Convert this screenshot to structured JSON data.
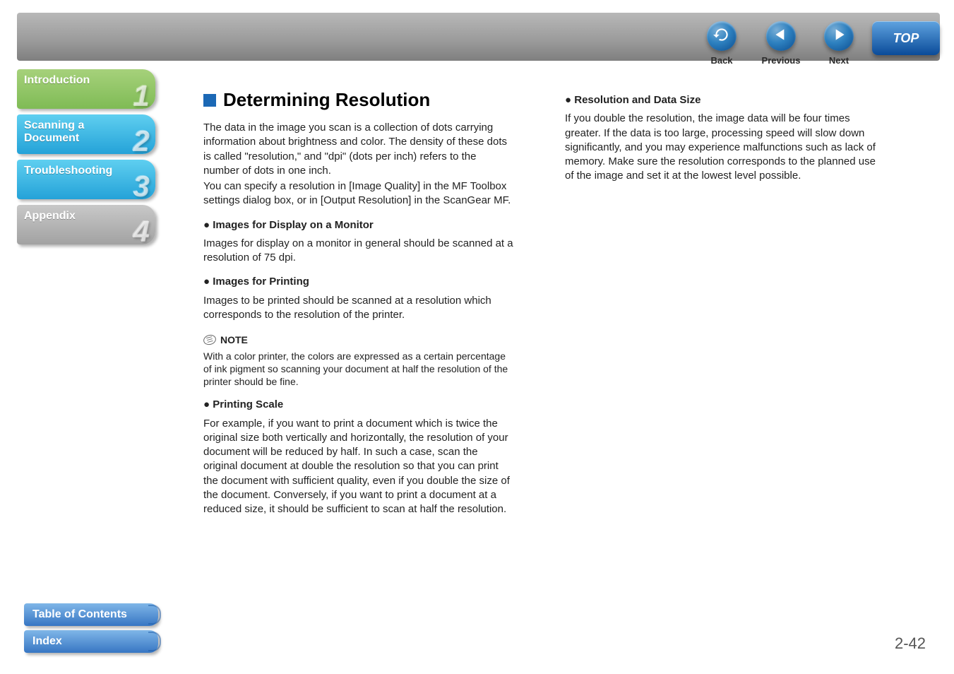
{
  "topnav": {
    "back": {
      "label": "Back"
    },
    "previous": {
      "label": "Previous"
    },
    "next": {
      "label": "Next"
    },
    "top": {
      "label": "TOP"
    }
  },
  "sidebar": {
    "tabs": [
      {
        "label": "Introduction",
        "num": "1",
        "color": "green"
      },
      {
        "label": "Scanning a\nDocument",
        "num": "2",
        "color": "cyan"
      },
      {
        "label": "Troubleshooting",
        "num": "3",
        "color": "cyan"
      },
      {
        "label": "Appendix",
        "num": "4",
        "color": "grey"
      }
    ]
  },
  "bottom": {
    "toc": "Table of Contents",
    "index": "Index"
  },
  "page_number": "2-42",
  "main": {
    "heading": "Determining Resolution",
    "intro1": "The data in the image you scan is a collection of dots carrying information about brightness and color. The density of these dots is called \"resolution,\" and \"dpi\" (dots per inch) refers to the number of dots in one inch.",
    "intro2": "You can specify a resolution in [Image Quality] in the MF Toolbox settings dialog box, or in [Output Resolution] in the ScanGear MF.",
    "sub1_title": "Images for Display on a Monitor",
    "sub1_body": "Images for display on a monitor in general should be scanned at a resolution of 75 dpi.",
    "sub2_title": "Images for Printing",
    "sub2_body": "Images to be printed should be scanned at a resolution which corresponds to the resolution of the printer.",
    "note_label": "NOTE",
    "note_body": "With a color printer, the colors are expressed as a certain percentage of ink pigment so scanning your document at half the resolution of the printer should be fine.",
    "sub3_title": "Printing Scale",
    "sub3_body": "For example, if you want to print a document which is twice the original size both vertically and horizontally, the resolution of your document will be reduced by half. In such a case, scan the original document at double the resolution so that you can print the document with sufficient quality, even if you double the size of the document. Conversely, if you want to print a document at a reduced size, it should be sufficient to scan at half the resolution.",
    "sub4_title": "Resolution and Data Size",
    "sub4_body": "If you double the resolution, the image data will be four times greater. If the data is too large, processing speed will slow down significantly, and you may experience malfunctions such as lack of memory. Make sure the resolution corresponds to the planned use of the image and set it at the lowest level possible."
  }
}
